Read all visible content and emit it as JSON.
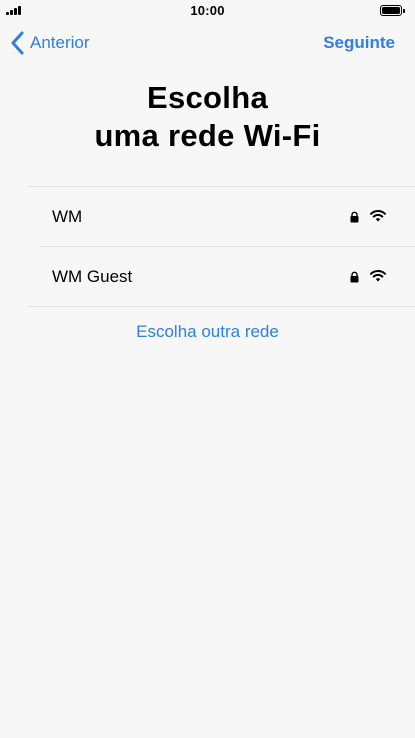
{
  "status_bar": {
    "time": "10:00"
  },
  "nav": {
    "back_label": "Anterior",
    "next_label": "Seguinte"
  },
  "title": {
    "line1": "Escolha",
    "line2": "uma rede Wi-Fi"
  },
  "networks": [
    {
      "name": "WM",
      "secured": true,
      "icons": [
        "lock-icon",
        "wifi-icon"
      ]
    },
    {
      "name": "WM Guest",
      "secured": true,
      "icons": [
        "lock-icon",
        "wifi-icon"
      ]
    }
  ],
  "other_network_label": "Escolha outra rede",
  "colors": {
    "accent": "#2f7fe0",
    "background": "#f7f7f8",
    "separator": "#e2e2e4"
  }
}
